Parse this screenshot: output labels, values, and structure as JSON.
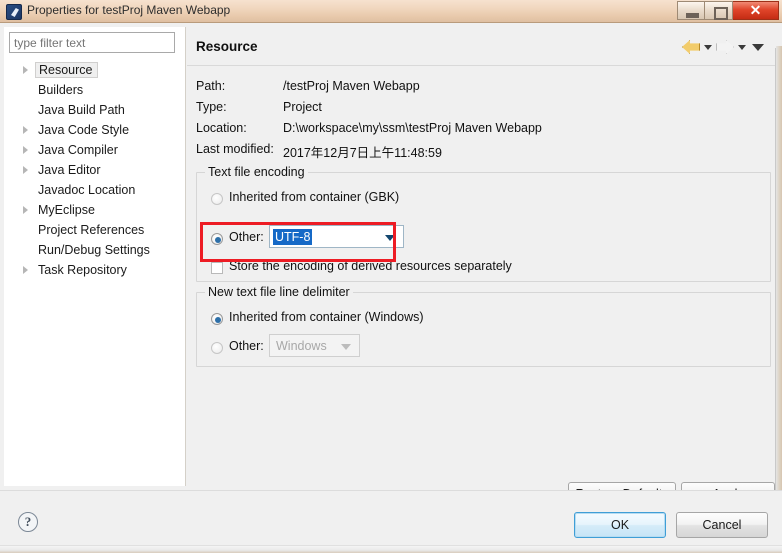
{
  "window": {
    "title": "Properties for testProj Maven Webapp",
    "app_icon": "myeclipse-icon",
    "minimize_label": "",
    "maximize_label": "",
    "close_label": "✕"
  },
  "sidebar": {
    "filter": {
      "value": "",
      "placeholder": "type filter text"
    },
    "items": [
      {
        "label": "Resource",
        "expandable": true,
        "selected": true
      },
      {
        "label": "Builders",
        "expandable": false,
        "selected": false
      },
      {
        "label": "Java Build Path",
        "expandable": false,
        "selected": false
      },
      {
        "label": "Java Code Style",
        "expandable": true,
        "selected": false
      },
      {
        "label": "Java Compiler",
        "expandable": true,
        "selected": false
      },
      {
        "label": "Java Editor",
        "expandable": true,
        "selected": false
      },
      {
        "label": "Javadoc Location",
        "expandable": false,
        "selected": false
      },
      {
        "label": "MyEclipse",
        "expandable": true,
        "selected": false
      },
      {
        "label": "Project References",
        "expandable": false,
        "selected": false
      },
      {
        "label": "Run/Debug Settings",
        "expandable": false,
        "selected": false
      },
      {
        "label": "Task Repository",
        "expandable": true,
        "selected": false
      }
    ]
  },
  "page": {
    "title": "Resource",
    "nav": {
      "back_icon": "back-arrow-icon",
      "back_menu_icon": "chevron-down-icon",
      "forward_icon": "forward-arrow-icon",
      "forward_menu_icon": "chevron-down-icon",
      "view_menu_icon": "chevron-down-icon"
    },
    "info": [
      {
        "label": "Path:",
        "value": "/testProj Maven Webapp"
      },
      {
        "label": "Type:",
        "value": "Project"
      },
      {
        "label": "Location:",
        "value": "D:\\workspace\\my\\ssm\\testProj Maven Webapp"
      },
      {
        "label": "Last modified:",
        "value": "2017年12月7日上午11:48:59"
      }
    ],
    "encoding_group": {
      "legend": "Text file encoding",
      "inherited_label": "Inherited from container (GBK)",
      "inherited_checked": false,
      "other_label": "Other:",
      "other_checked": true,
      "other_value": "UTF-8",
      "store_derived_label": "Store the encoding of derived resources separately",
      "store_derived_checked": false,
      "highlight_color": "#ed1c24",
      "selection_color": "#1569c7"
    },
    "delimiter_group": {
      "legend": "New text file line delimiter",
      "inherited_label": "Inherited from container (Windows)",
      "inherited_checked": true,
      "other_label": "Other:",
      "other_checked": false,
      "other_value": "Windows",
      "other_disabled": true
    },
    "buttons": {
      "restore_defaults": "Restore Defaults",
      "apply": "Apply"
    }
  },
  "footer": {
    "help_icon_glyph": "?",
    "ok": "OK",
    "cancel": "Cancel"
  }
}
